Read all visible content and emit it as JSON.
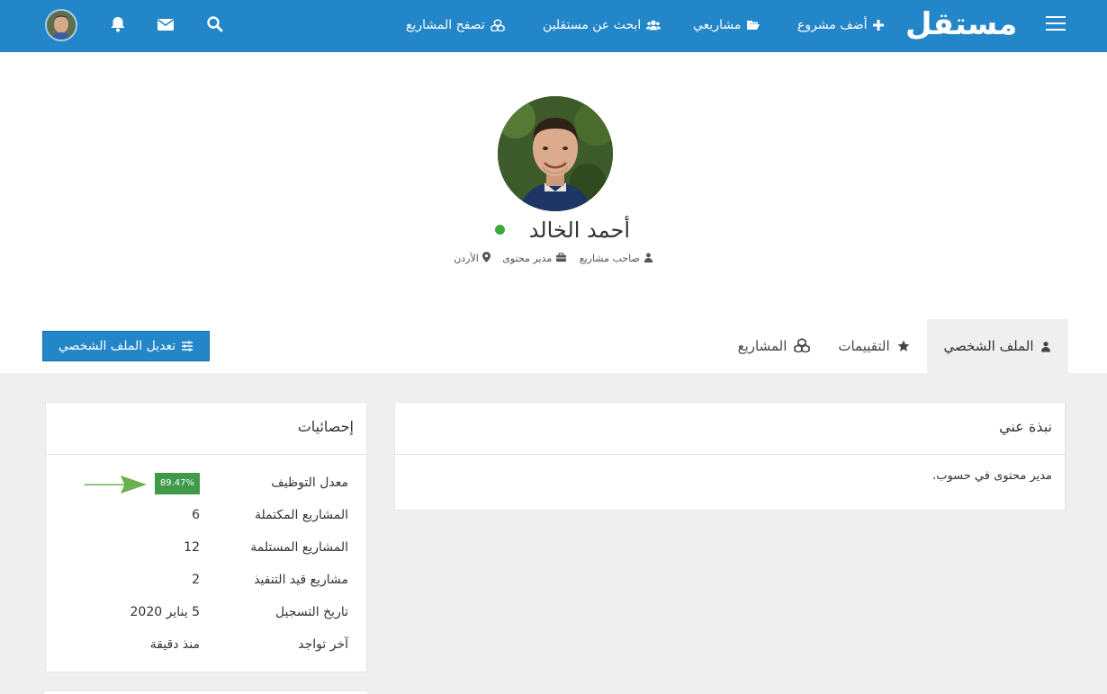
{
  "nav": {
    "logo_text": "مستقل",
    "links": {
      "add_project": "أضف مشروع",
      "my_projects": "مشاريعي",
      "find_freelancers": "ابحث عن مستقلين",
      "browse_projects": "تصفح المشاريع"
    },
    "icons": [
      "menu-icon",
      "plus-icon",
      "folder-open-icon",
      "users-icon",
      "cubes-icon",
      "search-icon",
      "envelope-icon",
      "bell-icon"
    ]
  },
  "profile": {
    "name": "أحمد الخالد",
    "status": "online",
    "role": "صاحب مشاريع",
    "job_title": "مدير محتوى",
    "location": "الأردن"
  },
  "tabs": {
    "profile": "الملف الشخصي",
    "reviews": "التقييمات",
    "projects": "المشاريع",
    "active": "profile"
  },
  "edit_button": "تعديل الملف الشخصي",
  "about": {
    "title": "نبذة عني",
    "text": "مدير محتوى في حسوب."
  },
  "stats": {
    "title": "إحصائيات",
    "hiring_rate_label": "معدل التوظيف",
    "hiring_rate_value": "89.47%",
    "rows": [
      {
        "label": "المشاريع المكتملة",
        "value": "6"
      },
      {
        "label": "المشاريع المستلمة",
        "value": "12"
      },
      {
        "label": "مشاريع قيد التنفيذ",
        "value": "2"
      },
      {
        "label": "تاريخ التسجيل",
        "value": "5 يناير 2020"
      },
      {
        "label": "آخر تواجد",
        "value": "منذ دقيقة"
      }
    ]
  },
  "colors": {
    "primary": "#2386c8",
    "badge_green": "#3f9a4a",
    "arrow_green": "#6ab04c",
    "online": "#3aa83a",
    "background_gray": "#efefef"
  }
}
